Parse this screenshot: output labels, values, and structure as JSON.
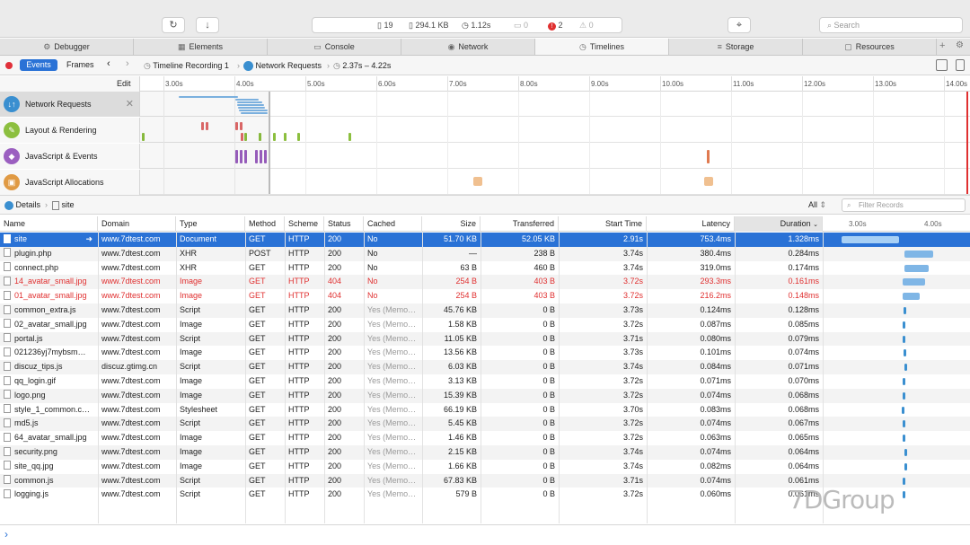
{
  "toolbar": {
    "reload_icon": "↻",
    "download_icon": "↓",
    "resources_count": "19",
    "size": "294.1 KB",
    "time": "1.12s",
    "logs": "0",
    "errors": "2",
    "warnings": "0",
    "target_icon": "⌖",
    "search_placeholder": "Search"
  },
  "tabs": [
    {
      "label": "Debugger",
      "icon": "⚙"
    },
    {
      "label": "Elements",
      "icon": "▦"
    },
    {
      "label": "Console",
      "icon": "▭"
    },
    {
      "label": "Network",
      "icon": "◉"
    },
    {
      "label": "Timelines",
      "icon": "◷"
    },
    {
      "label": "Storage",
      "icon": "≡"
    },
    {
      "label": "Resources",
      "icon": "▢"
    }
  ],
  "crumbs": {
    "events": "Events",
    "frames": "Frames",
    "recording": "Timeline Recording 1",
    "network": "Network Requests",
    "range": "2.37s – 4.22s"
  },
  "ruler": {
    "edit": "Edit",
    "ticks": [
      "3.00s",
      "4.00s",
      "5.00s",
      "6.00s",
      "7.00s",
      "8.00s",
      "9.00s",
      "10.00s",
      "11.00s",
      "12.00s",
      "13.00s",
      "14.00s"
    ]
  },
  "overview": [
    {
      "label": "Network Requests",
      "color": "#3a8fd0",
      "icon": "↓↑"
    },
    {
      "label": "Layout & Rendering",
      "color": "#8cbf3f",
      "icon": "✎"
    },
    {
      "label": "JavaScript & Events",
      "color": "#9b5fc0",
      "icon": "◆"
    },
    {
      "label": "JavaScript Allocations",
      "color": "#e09a44",
      "icon": "▣"
    }
  ],
  "details": {
    "label": "Details",
    "site": "site",
    "filter_all": "All",
    "filter_placeholder": "Filter Records"
  },
  "columns": [
    "Name",
    "Domain",
    "Type",
    "Method",
    "Scheme",
    "Status",
    "Cached",
    "Size",
    "Transferred",
    "Start Time",
    "Latency",
    "Duration"
  ],
  "waterfall_ticks": [
    "3.00s",
    "4.00s"
  ],
  "rows": [
    {
      "name": "site",
      "domain": "www.7dtest.com",
      "type": "Document",
      "method": "GET",
      "scheme": "HTTP",
      "status": "200",
      "cached": "No",
      "size": "51.70 KB",
      "transferred": "52.05 KB",
      "start": "2.91s",
      "latency": "753.4ms",
      "duration": "1.328ms"
    },
    {
      "name": "plugin.php",
      "domain": "www.7dtest.com",
      "type": "XHR",
      "method": "POST",
      "scheme": "HTTP",
      "status": "200",
      "cached": "No",
      "size": "—",
      "transferred": "238 B",
      "start": "3.74s",
      "latency": "380.4ms",
      "duration": "0.284ms"
    },
    {
      "name": "connect.php",
      "domain": "www.7dtest.com",
      "type": "XHR",
      "method": "GET",
      "scheme": "HTTP",
      "status": "200",
      "cached": "No",
      "size": "63 B",
      "transferred": "460 B",
      "start": "3.74s",
      "latency": "319.0ms",
      "duration": "0.174ms"
    },
    {
      "name": "14_avatar_small.jpg",
      "domain": "www.7dtest.com",
      "type": "Image",
      "method": "GET",
      "scheme": "HTTP",
      "status": "404",
      "cached": "No",
      "size": "254 B",
      "transferred": "403 B",
      "start": "3.72s",
      "latency": "293.3ms",
      "duration": "0.161ms"
    },
    {
      "name": "01_avatar_small.jpg",
      "domain": "www.7dtest.com",
      "type": "Image",
      "method": "GET",
      "scheme": "HTTP",
      "status": "404",
      "cached": "No",
      "size": "254 B",
      "transferred": "403 B",
      "start": "3.72s",
      "latency": "216.2ms",
      "duration": "0.148ms"
    },
    {
      "name": "common_extra.js",
      "domain": "www.7dtest.com",
      "type": "Script",
      "method": "GET",
      "scheme": "HTTP",
      "status": "200",
      "cached": "Yes (Memo…",
      "size": "45.76 KB",
      "transferred": "0 B",
      "start": "3.73s",
      "latency": "0.124ms",
      "duration": "0.128ms"
    },
    {
      "name": "02_avatar_small.jpg",
      "domain": "www.7dtest.com",
      "type": "Image",
      "method": "GET",
      "scheme": "HTTP",
      "status": "200",
      "cached": "Yes (Memo…",
      "size": "1.58 KB",
      "transferred": "0 B",
      "start": "3.72s",
      "latency": "0.087ms",
      "duration": "0.085ms"
    },
    {
      "name": "portal.js",
      "domain": "www.7dtest.com",
      "type": "Script",
      "method": "GET",
      "scheme": "HTTP",
      "status": "200",
      "cached": "Yes (Memo…",
      "size": "11.05 KB",
      "transferred": "0 B",
      "start": "3.71s",
      "latency": "0.080ms",
      "duration": "0.079ms"
    },
    {
      "name": "021236yj7mybsm…",
      "domain": "www.7dtest.com",
      "type": "Image",
      "method": "GET",
      "scheme": "HTTP",
      "status": "200",
      "cached": "Yes (Memo…",
      "size": "13.56 KB",
      "transferred": "0 B",
      "start": "3.73s",
      "latency": "0.101ms",
      "duration": "0.074ms"
    },
    {
      "name": "discuz_tips.js",
      "domain": "discuz.gtimg.cn",
      "type": "Script",
      "method": "GET",
      "scheme": "HTTP",
      "status": "200",
      "cached": "Yes (Memo…",
      "size": "6.03 KB",
      "transferred": "0 B",
      "start": "3.74s",
      "latency": "0.084ms",
      "duration": "0.071ms"
    },
    {
      "name": "qq_login.gif",
      "domain": "www.7dtest.com",
      "type": "Image",
      "method": "GET",
      "scheme": "HTTP",
      "status": "200",
      "cached": "Yes (Memo…",
      "size": "3.13 KB",
      "transferred": "0 B",
      "start": "3.72s",
      "latency": "0.071ms",
      "duration": "0.070ms"
    },
    {
      "name": "logo.png",
      "domain": "www.7dtest.com",
      "type": "Image",
      "method": "GET",
      "scheme": "HTTP",
      "status": "200",
      "cached": "Yes (Memo…",
      "size": "15.39 KB",
      "transferred": "0 B",
      "start": "3.72s",
      "latency": "0.074ms",
      "duration": "0.068ms"
    },
    {
      "name": "style_1_common.c…",
      "domain": "www.7dtest.com",
      "type": "Stylesheet",
      "method": "GET",
      "scheme": "HTTP",
      "status": "200",
      "cached": "Yes (Memo…",
      "size": "66.19 KB",
      "transferred": "0 B",
      "start": "3.70s",
      "latency": "0.083ms",
      "duration": "0.068ms"
    },
    {
      "name": "md5.js",
      "domain": "www.7dtest.com",
      "type": "Script",
      "method": "GET",
      "scheme": "HTTP",
      "status": "200",
      "cached": "Yes (Memo…",
      "size": "5.45 KB",
      "transferred": "0 B",
      "start": "3.72s",
      "latency": "0.074ms",
      "duration": "0.067ms"
    },
    {
      "name": "64_avatar_small.jpg",
      "domain": "www.7dtest.com",
      "type": "Image",
      "method": "GET",
      "scheme": "HTTP",
      "status": "200",
      "cached": "Yes (Memo…",
      "size": "1.46 KB",
      "transferred": "0 B",
      "start": "3.72s",
      "latency": "0.063ms",
      "duration": "0.065ms"
    },
    {
      "name": "security.png",
      "domain": "www.7dtest.com",
      "type": "Image",
      "method": "GET",
      "scheme": "HTTP",
      "status": "200",
      "cached": "Yes (Memo…",
      "size": "2.15 KB",
      "transferred": "0 B",
      "start": "3.74s",
      "latency": "0.074ms",
      "duration": "0.064ms"
    },
    {
      "name": "site_qq.jpg",
      "domain": "www.7dtest.com",
      "type": "Image",
      "method": "GET",
      "scheme": "HTTP",
      "status": "200",
      "cached": "Yes (Memo…",
      "size": "1.66 KB",
      "transferred": "0 B",
      "start": "3.74s",
      "latency": "0.082ms",
      "duration": "0.064ms"
    },
    {
      "name": "common.js",
      "domain": "www.7dtest.com",
      "type": "Script",
      "method": "GET",
      "scheme": "HTTP",
      "status": "200",
      "cached": "Yes (Memo…",
      "size": "67.83 KB",
      "transferred": "0 B",
      "start": "3.71s",
      "latency": "0.074ms",
      "duration": "0.061ms"
    },
    {
      "name": "logging.js",
      "domain": "www.7dtest.com",
      "type": "Script",
      "method": "GET",
      "scheme": "HTTP",
      "status": "200",
      "cached": "Yes (Memo…",
      "size": "579 B",
      "transferred": "0 B",
      "start": "3.72s",
      "latency": "0.060ms",
      "duration": "0.061ms"
    }
  ],
  "console_prompt": "›",
  "watermark": "7DGroup",
  "colors": {
    "accent": "#2a72d6",
    "error": "#e03030"
  }
}
